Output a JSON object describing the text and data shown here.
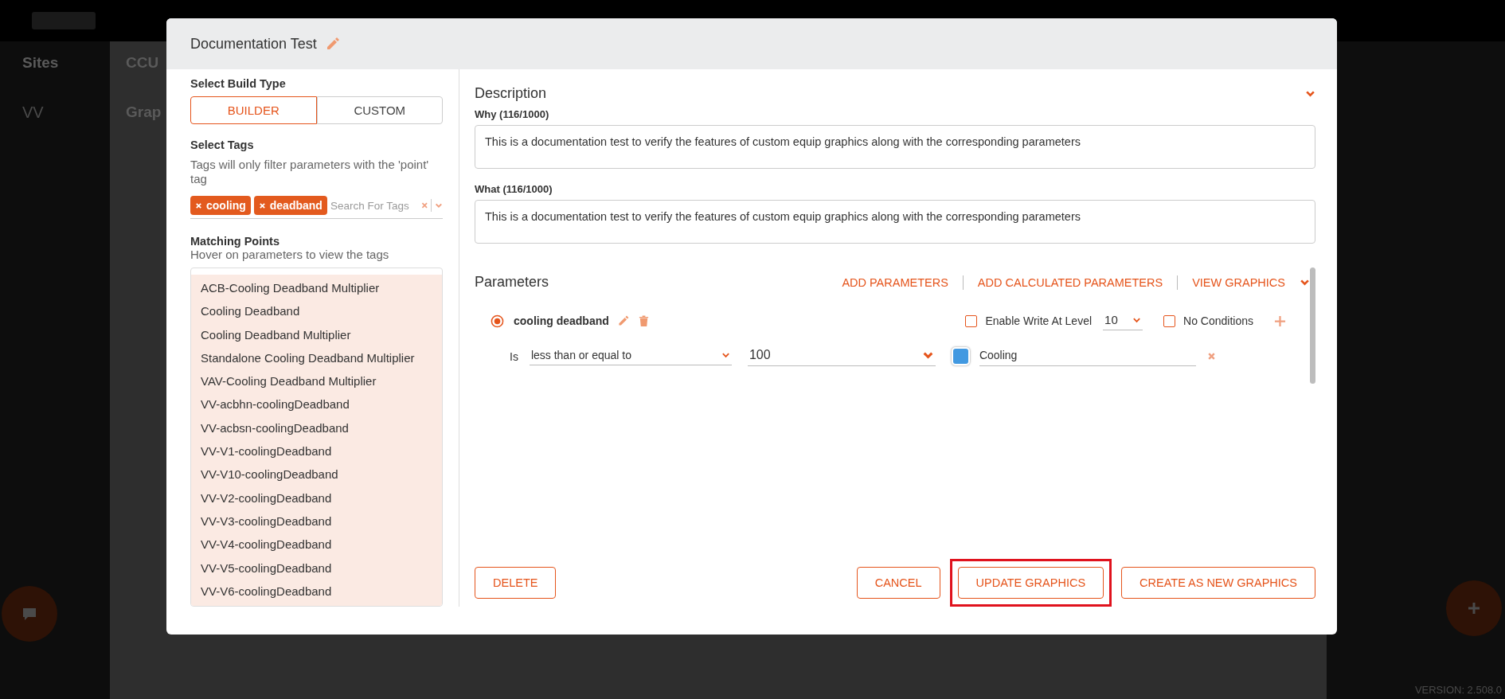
{
  "background": {
    "nav_item": "Sites",
    "panel_title": "CCU",
    "section_title": "Grap",
    "equip_title": "VV",
    "version": "VERSION: 2.508.0"
  },
  "dialog": {
    "title": "Documentation Test",
    "build_type": {
      "label": "Select Build Type",
      "options": [
        {
          "label": "BUILDER",
          "selected": true
        },
        {
          "label": "CUSTOM",
          "selected": false
        }
      ]
    },
    "tags": {
      "label": "Select Tags",
      "hint": "Tags will only filter parameters with the 'point' tag",
      "chips": [
        "cooling",
        "deadband"
      ],
      "placeholder": "Search For Tags"
    },
    "matching_points": {
      "label": "Matching Points",
      "hint": "Hover on parameters to view the tags",
      "items": [
        "ACB-Cooling Deadband Multiplier",
        "Cooling Deadband",
        "Cooling Deadband Multiplier",
        "Standalone Cooling Deadband Multiplier",
        "VAV-Cooling Deadband Multiplier",
        "VV-acbhn-coolingDeadband",
        "VV-acbsn-coolingDeadband",
        "VV-V1-coolingDeadband",
        "VV-V10-coolingDeadband",
        "VV-V2-coolingDeadband",
        "VV-V3-coolingDeadband",
        "VV-V4-coolingDeadband",
        "VV-V5-coolingDeadband",
        "VV-V6-coolingDeadband"
      ]
    },
    "description": {
      "title": "Description",
      "fields": [
        {
          "label": "Why (116/1000)",
          "value": "This is a documentation test to verify the features of custom equip graphics along with the corresponding parameters"
        },
        {
          "label": "What (116/1000)",
          "value": "This is a documentation test to verify the features of custom equip graphics along with the corresponding parameters"
        }
      ]
    },
    "parameters": {
      "title": "Parameters",
      "actions": [
        "ADD PARAMETERS",
        "ADD CALCULATED PARAMETERS",
        "VIEW GRAPHICS"
      ],
      "items": [
        {
          "name": "cooling deadband",
          "selected": true,
          "enable_write": false,
          "write_label": "Enable Write At Level",
          "write_level": "10",
          "no_conditions": false,
          "no_conditions_label": "No Conditions",
          "condition": {
            "prefix": "Is",
            "operator": "less than or equal to",
            "value": "100",
            "color": "#4299e1",
            "label": "Cooling"
          }
        }
      ]
    },
    "buttons": [
      {
        "label": "DELETE",
        "highlighted": false
      },
      {
        "label": "CANCEL",
        "highlighted": false
      },
      {
        "label": "UPDATE GRAPHICS",
        "highlighted": true
      },
      {
        "label": "CREATE AS NEW GRAPHICS",
        "highlighted": false
      }
    ]
  }
}
